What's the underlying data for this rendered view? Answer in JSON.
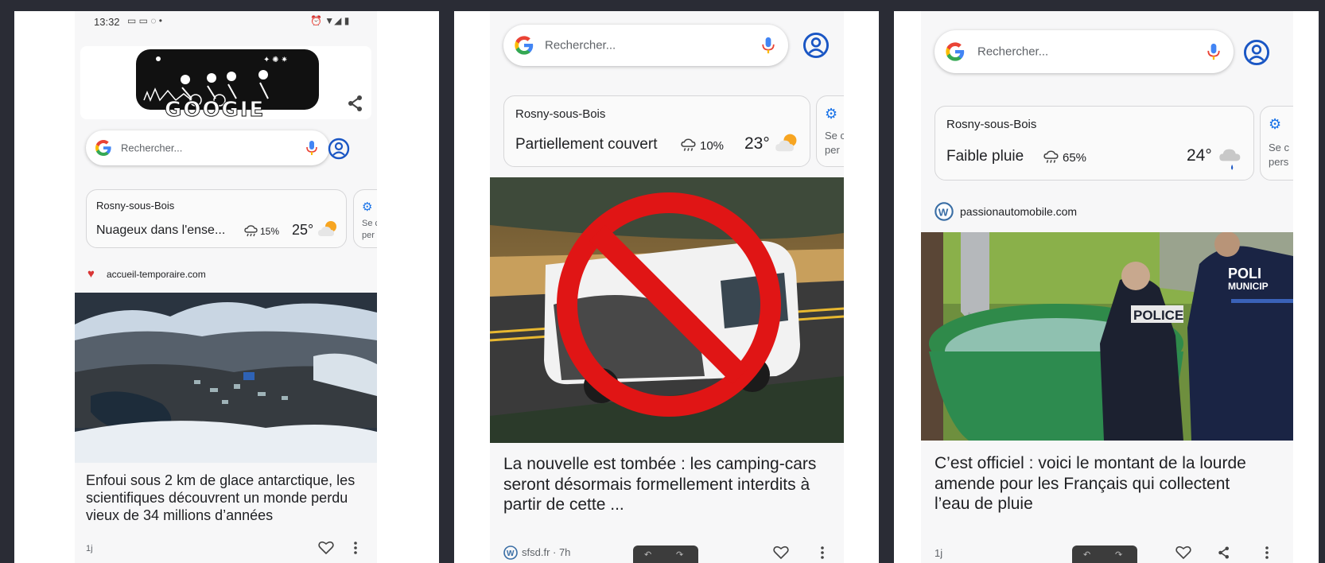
{
  "panels": [
    {
      "status": {
        "time": "13:32"
      },
      "search": {
        "placeholder": "Rechercher..."
      },
      "weather": {
        "city": "Rosny-sous-Bois",
        "condition": "Nuageux dans l'ense...",
        "rain": "15%",
        "temp": "25°"
      },
      "settings_text": [
        "Se c",
        "per"
      ],
      "source": "accueil-temporaire.com",
      "headline": "Enfoui sous 2 km de glace antarctique, les scientifiques découvrent un monde perdu vieux de 34 millions d’années",
      "meta": "1j"
    },
    {
      "search": {
        "placeholder": "Rechercher..."
      },
      "weather": {
        "city": "Rosny-sous-Bois",
        "condition": "Partiellement couvert",
        "rain": "10%",
        "temp": "23°"
      },
      "settings_text": [
        "Se c",
        "per"
      ],
      "headline": "La nouvelle est tombée : les camping-cars seront désormais formellement interdits à partir de cette ...",
      "meta": "sfsd.fr · 7h"
    },
    {
      "search": {
        "placeholder": "Rechercher..."
      },
      "weather": {
        "city": "Rosny-sous-Bois",
        "condition": "Faible pluie",
        "rain": "65%",
        "temp": "24°"
      },
      "settings_text": [
        "Se c",
        "pers"
      ],
      "source": "passionautomobile.com",
      "image_text": {
        "police": "POLICE",
        "police_mun_1": "POLI",
        "police_mun_2": "MUNICIP"
      },
      "headline": "C’est officiel : voici le montant de la lourde amende pour les Français qui collectent l’eau de pluie",
      "meta": "1j"
    }
  ],
  "colors": {
    "google_blue": "#4285F4",
    "google_red": "#EA4335",
    "google_yellow": "#FBBC05",
    "google_green": "#34A853",
    "account_blue": "#1a56c4",
    "background": "#2a2c35"
  },
  "icons": [
    "google-logo-icon",
    "mic-icon",
    "account-icon",
    "rain-cloud-icon",
    "weather-partly-cloudy-icon",
    "settings-gear-icon",
    "heart-icon",
    "more-vert-icon",
    "share-icon",
    "wordpress-icon"
  ]
}
